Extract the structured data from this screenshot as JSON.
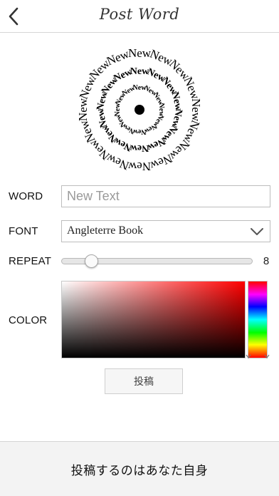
{
  "nav": {
    "title": "Post Word",
    "back_icon": "chevron-left-icon"
  },
  "preview": {
    "word": "New",
    "style": "circular-rings"
  },
  "word": {
    "label": "WORD",
    "value": "",
    "placeholder": "New Text"
  },
  "font": {
    "label": "FONT",
    "selected": "Angleterre Book",
    "icon": "chevron-down-icon"
  },
  "repeat": {
    "label": "REPEAT",
    "value": "8",
    "fraction": 0.13
  },
  "color": {
    "label": "COLOR",
    "selected_hue": "#ff0000"
  },
  "post_button": {
    "label": "投稿"
  },
  "footer": {
    "text": "投稿するのはあなた自身"
  }
}
